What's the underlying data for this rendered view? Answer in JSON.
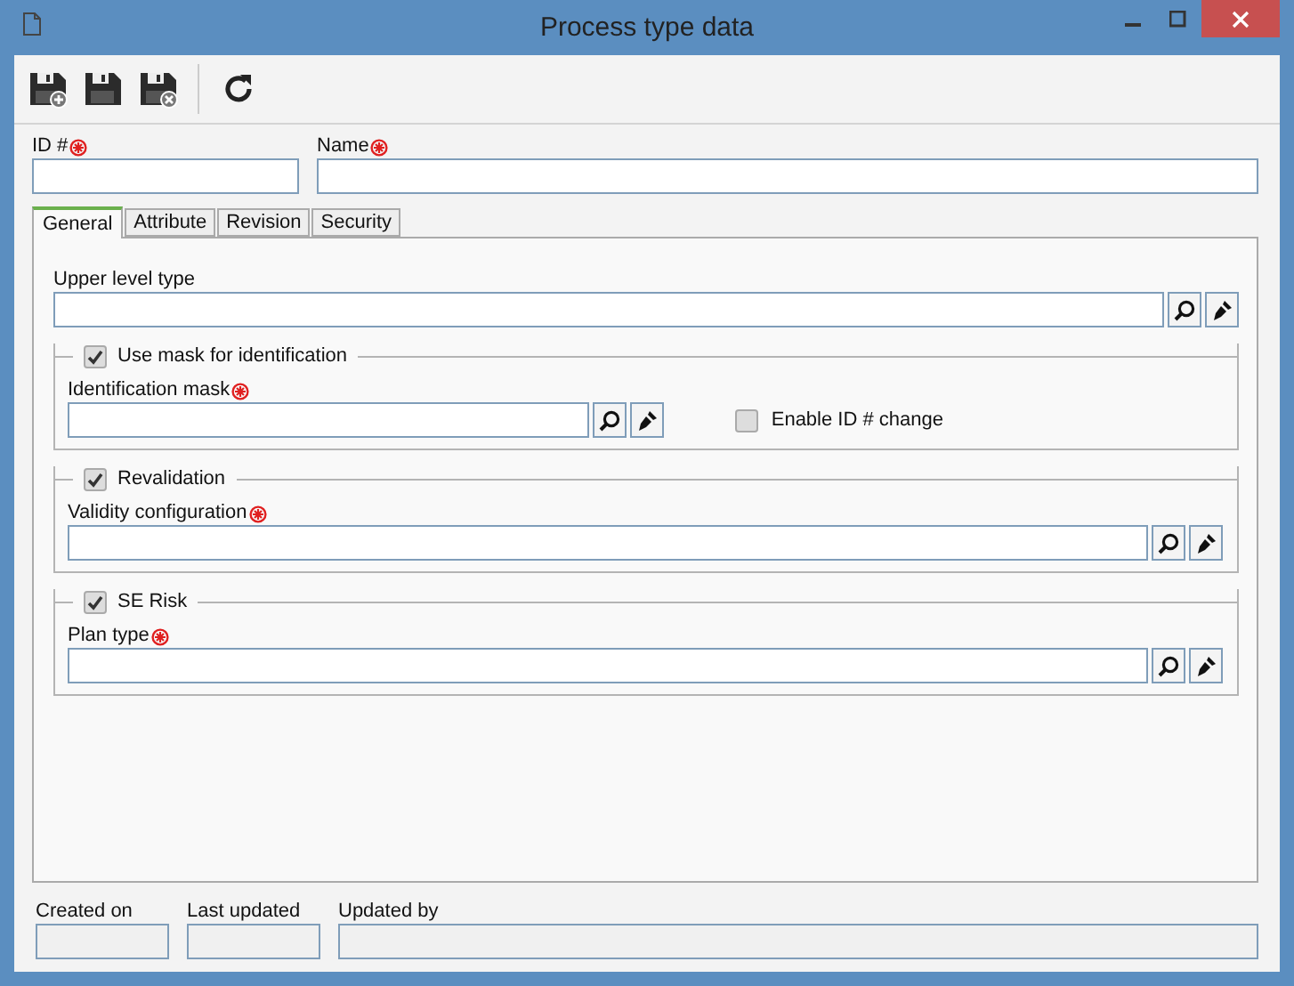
{
  "window": {
    "title": "Process type data"
  },
  "header_fields": [
    {
      "label": "ID #",
      "required": true,
      "kind": "short"
    },
    {
      "label": "Name",
      "required": true,
      "kind": "wide"
    }
  ],
  "tabs": [
    {
      "label": "General",
      "selected": true
    },
    {
      "label": "Attribute",
      "selected": false
    },
    {
      "label": "Revision",
      "selected": false
    },
    {
      "label": "Security",
      "selected": false
    }
  ],
  "general": {
    "upper_level_type": {
      "label": "Upper level type",
      "required": false
    },
    "groups": [
      {
        "label": "Use mask for identification",
        "checked": true,
        "field": {
          "label": "Identification mask",
          "required": true
        },
        "option": {
          "label": "Enable ID # change",
          "checked": false
        }
      },
      {
        "label": "Revalidation",
        "checked": true,
        "field": {
          "label": "Validity configuration",
          "required": true
        }
      },
      {
        "label": "SE Risk",
        "checked": true,
        "field": {
          "label": "Plan type",
          "required": true
        }
      }
    ]
  },
  "footer_fields": [
    {
      "label": "Created on",
      "disabled": true,
      "kind": "short"
    },
    {
      "label": "Last updated",
      "disabled": true,
      "kind": "short"
    },
    {
      "label": "Updated by",
      "disabled": true,
      "kind": "wide"
    }
  ]
}
